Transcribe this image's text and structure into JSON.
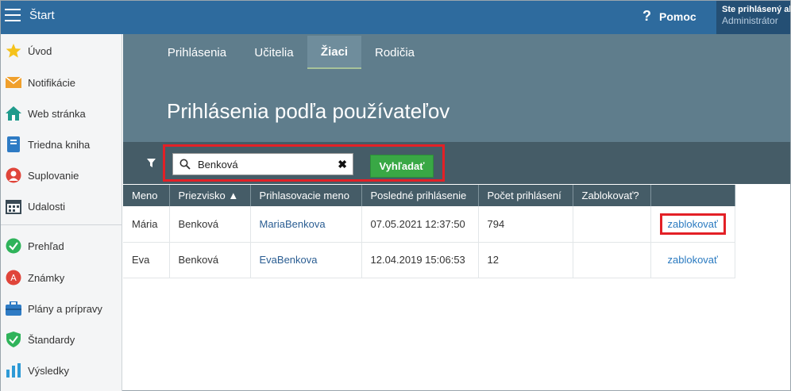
{
  "header": {
    "app_title": "Štart",
    "help_icon": "?",
    "help_label": "Pomoc",
    "user_line1": "Ste prihlásený ako",
    "user_line2": "Administrátor"
  },
  "sidebar": {
    "items": [
      {
        "label": "Úvod",
        "icon": "star-icon"
      },
      {
        "label": "Notifikácie",
        "icon": "envelope-icon"
      },
      {
        "label": "Web stránka",
        "icon": "home-icon"
      },
      {
        "label": "Triedna kniha",
        "icon": "book-icon"
      },
      {
        "label": "Suplovanie",
        "icon": "person-icon"
      },
      {
        "label": "Udalosti",
        "icon": "calendar-icon"
      },
      {
        "label": "Prehľad",
        "icon": "check-circle-icon"
      },
      {
        "label": "Známky",
        "icon": "grade-icon"
      },
      {
        "label": "Plány a prípravy",
        "icon": "briefcase-icon"
      },
      {
        "label": "Štandardy",
        "icon": "shield-check-icon"
      },
      {
        "label": "Výsledky",
        "icon": "bar-chart-icon"
      }
    ]
  },
  "tabs": [
    {
      "label": "Prihlásenia"
    },
    {
      "label": "Učitelia"
    },
    {
      "label": "Žiaci"
    },
    {
      "label": "Rodičia"
    }
  ],
  "active_tab": "Žiaci",
  "page_title": "Prihlásenia podľa používateľov",
  "search": {
    "value": "Benková",
    "clear_icon": "✖",
    "button_label": "Vyhľadať"
  },
  "table": {
    "headers": [
      "Meno",
      "Priezvisko ▲",
      "Prihlasovacie meno",
      "Posledné prihlásenie",
      "Počet prihlásení",
      "Zablokovať?",
      ""
    ],
    "rows": [
      {
        "meno": "Mária",
        "priezvisko": "Benková",
        "login": "MariaBenkova",
        "last": "07.05.2021 12:37:50",
        "count": "794",
        "blocked": "",
        "action": "zablokovať"
      },
      {
        "meno": "Eva",
        "priezvisko": "Benková",
        "login": "EvaBenkova",
        "last": "12.04.2019 15:06:53",
        "count": "12",
        "blocked": "",
        "action": "zablokovať"
      }
    ]
  },
  "colors": {
    "topbar": "#2e6b9e",
    "main_header": "#5f7d8c",
    "filter_bar": "#455c67",
    "search_button": "#39a845",
    "highlight": "#e32026"
  }
}
